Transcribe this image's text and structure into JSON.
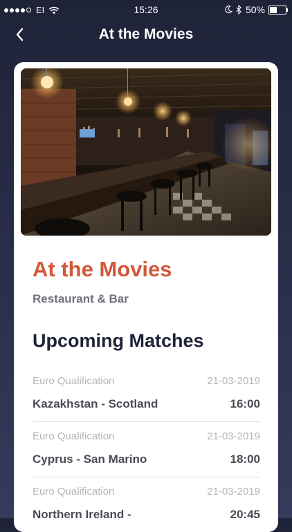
{
  "status_bar": {
    "carrier": "EI",
    "time": "15:26",
    "battery_percent": "50%",
    "battery_level": 0.5
  },
  "nav": {
    "title": "At the Movies",
    "back_icon": "chevron-left-icon"
  },
  "venue": {
    "name": "At the Movies",
    "type": "Restaurant & Bar",
    "accent_color": "#d3573a"
  },
  "matches_section": {
    "title": "Upcoming Matches",
    "matches": [
      {
        "competition": "Euro Qualification",
        "date": "21-03-2019",
        "teams": "Kazakhstan - Scotland",
        "time": "16:00"
      },
      {
        "competition": "Euro Qualification",
        "date": "21-03-2019",
        "teams": "Cyprus - San Marino",
        "time": "18:00"
      },
      {
        "competition": "Euro Qualification",
        "date": "21-03-2019",
        "teams": "Northern Ireland -",
        "time": "20:45"
      }
    ]
  }
}
